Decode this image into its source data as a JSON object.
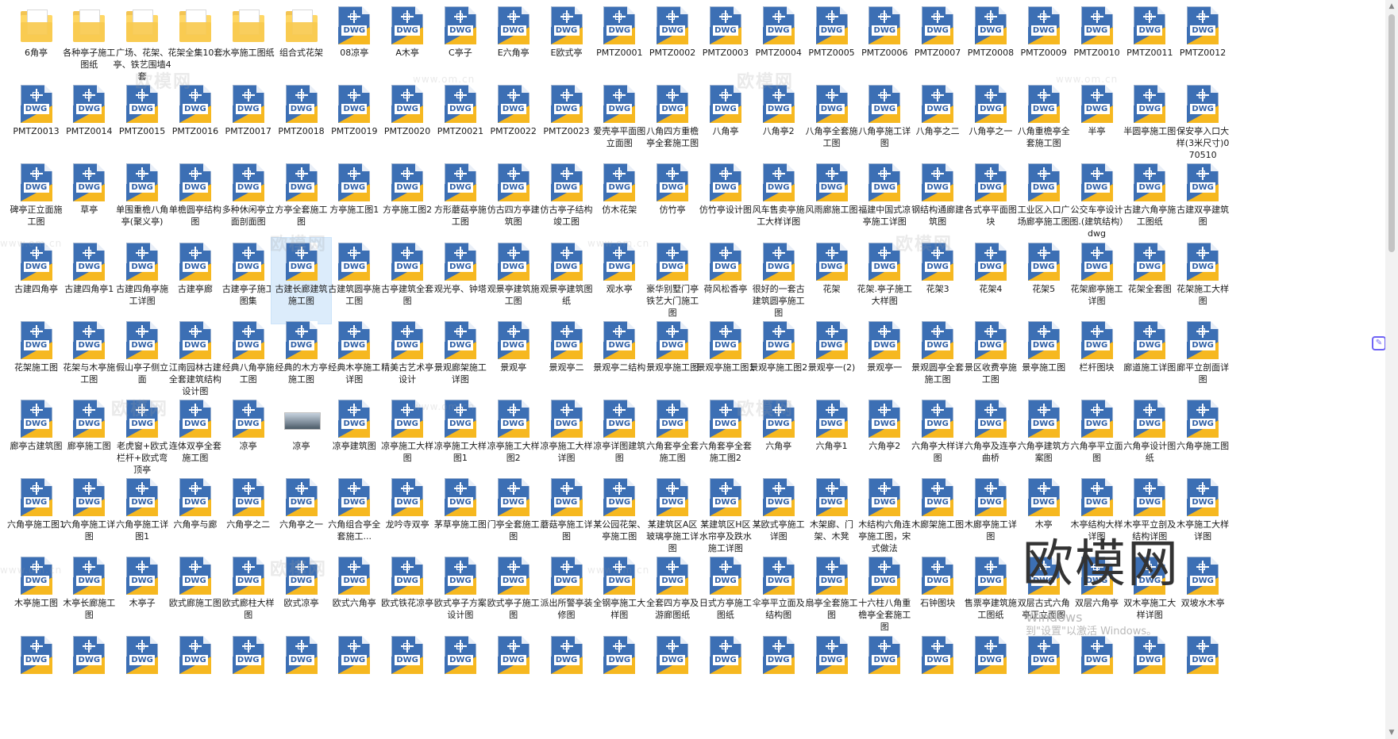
{
  "icon_badge": "DWG",
  "colors": {
    "dwg_blue": "#3c6fb4",
    "dwg_yellow": "#f6b820",
    "folder": "#ffd765",
    "selection": "#dcecfb"
  },
  "watermarks": {
    "brand": "欧模网",
    "url": "www.om.cn"
  },
  "big_watermark": "欧模网",
  "activation": {
    "line1": "Windows",
    "line2": "到\"设置\"以激活 Windows。"
  },
  "selected_index": 74,
  "files": [
    {
      "name": "6角亭",
      "type": "folder"
    },
    {
      "name": "各种亭子施工图纸",
      "type": "folder"
    },
    {
      "name": "广场、花架、亭、铁艺围墙4套",
      "type": "folder"
    },
    {
      "name": "花架全集10套",
      "type": "folder"
    },
    {
      "name": "水亭施工图纸",
      "type": "folder"
    },
    {
      "name": "组合式花架",
      "type": "folder"
    },
    {
      "name": "08凉亭",
      "type": "dwg"
    },
    {
      "name": "A木亭",
      "type": "dwg"
    },
    {
      "name": "C亭子",
      "type": "dwg"
    },
    {
      "name": "E六角亭",
      "type": "dwg"
    },
    {
      "name": "E欧式亭",
      "type": "dwg"
    },
    {
      "name": "PMTZ0001",
      "type": "dwg"
    },
    {
      "name": "PMTZ0002",
      "type": "dwg"
    },
    {
      "name": "PMTZ0003",
      "type": "dwg"
    },
    {
      "name": "PMTZ0004",
      "type": "dwg"
    },
    {
      "name": "PMTZ0005",
      "type": "dwg"
    },
    {
      "name": "PMTZ0006",
      "type": "dwg"
    },
    {
      "name": "PMTZ0007",
      "type": "dwg"
    },
    {
      "name": "PMTZ0008",
      "type": "dwg"
    },
    {
      "name": "PMTZ0009",
      "type": "dwg"
    },
    {
      "name": "PMTZ0010",
      "type": "dwg"
    },
    {
      "name": "PMTZ0011",
      "type": "dwg"
    },
    {
      "name": "PMTZ0012",
      "type": "dwg"
    },
    {
      "name": "PMTZ0013",
      "type": "dwg"
    },
    {
      "name": "PMTZ0014",
      "type": "dwg"
    },
    {
      "name": "PMTZ0015",
      "type": "dwg"
    },
    {
      "name": "PMTZ0016",
      "type": "dwg"
    },
    {
      "name": "PMTZ0017",
      "type": "dwg"
    },
    {
      "name": "PMTZ0018",
      "type": "dwg"
    },
    {
      "name": "PMTZ0019",
      "type": "dwg"
    },
    {
      "name": "PMTZ0020",
      "type": "dwg"
    },
    {
      "name": "PMTZ0021",
      "type": "dwg"
    },
    {
      "name": "PMTZ0022",
      "type": "dwg"
    },
    {
      "name": "PMTZ0023",
      "type": "dwg"
    },
    {
      "name": "爱壳亭平面图立面图",
      "type": "dwg"
    },
    {
      "name": "八角四方重檐亭全套施工图",
      "type": "dwg"
    },
    {
      "name": "八角亭",
      "type": "dwg"
    },
    {
      "name": "八角亭2",
      "type": "dwg"
    },
    {
      "name": "八角亭全套施工图",
      "type": "dwg"
    },
    {
      "name": "八角亭施工详图",
      "type": "dwg"
    },
    {
      "name": "八角亭之二",
      "type": "dwg"
    },
    {
      "name": "八角亭之一",
      "type": "dwg"
    },
    {
      "name": "八角重檐亭全套施工图",
      "type": "dwg"
    },
    {
      "name": "半亭",
      "type": "dwg"
    },
    {
      "name": "半圆亭施工图",
      "type": "dwg"
    },
    {
      "name": "保安亭入口大样(3米尺寸)070510",
      "type": "dwg"
    },
    {
      "name": "碑亭正立面施工图",
      "type": "dwg"
    },
    {
      "name": "草亭",
      "type": "dwg"
    },
    {
      "name": "单围重檐八角亭(聚义亭)",
      "type": "dwg"
    },
    {
      "name": "单檐圆亭结构图",
      "type": "dwg"
    },
    {
      "name": "多种休闲亭立面剖面图",
      "type": "dwg"
    },
    {
      "name": "方亭全套施工图",
      "type": "dwg"
    },
    {
      "name": "方亭施工图1",
      "type": "dwg"
    },
    {
      "name": "方亭施工图2",
      "type": "dwg"
    },
    {
      "name": "方形蘑菇亭施工图",
      "type": "dwg"
    },
    {
      "name": "仿古四方亭建筑图",
      "type": "dwg"
    },
    {
      "name": "仿古亭子结构竣工图",
      "type": "dwg"
    },
    {
      "name": "仿木花架",
      "type": "dwg"
    },
    {
      "name": "仿竹亭",
      "type": "dwg"
    },
    {
      "name": "仿竹亭设计图",
      "type": "dwg"
    },
    {
      "name": "风车售卖亭施工大样详图",
      "type": "dwg"
    },
    {
      "name": "风雨廊施工图",
      "type": "dwg"
    },
    {
      "name": "福建中国式凉亭施工详图",
      "type": "dwg"
    },
    {
      "name": "钢结构通廊建筑图",
      "type": "dwg"
    },
    {
      "name": "各式亭平面图块",
      "type": "dwg"
    },
    {
      "name": "工业区入口广场廊亭施工图",
      "type": "dwg"
    },
    {
      "name": "公交车亭设计图.(建筑结构）dwg",
      "type": "dwg"
    },
    {
      "name": "古建六角亭施工图纸",
      "type": "dwg"
    },
    {
      "name": "古建双亭建筑图",
      "type": "dwg"
    },
    {
      "name": "古建四角亭",
      "type": "dwg"
    },
    {
      "name": "古建四角亭1",
      "type": "dwg"
    },
    {
      "name": "古建四角亭施工详图",
      "type": "dwg"
    },
    {
      "name": "古建亭廊",
      "type": "dwg"
    },
    {
      "name": "古建亭子施工图集",
      "type": "dwg"
    },
    {
      "name": "古建长廊建筑施工图",
      "type": "dwg"
    },
    {
      "name": "古建筑圆亭施工图",
      "type": "dwg"
    },
    {
      "name": "古亭建筑全套图",
      "type": "dwg"
    },
    {
      "name": "观光亭、钟塔",
      "type": "dwg"
    },
    {
      "name": "观景亭建筑施工图",
      "type": "dwg"
    },
    {
      "name": "观景亭建筑图纸",
      "type": "dwg"
    },
    {
      "name": "观水亭",
      "type": "dwg"
    },
    {
      "name": "豪华别墅门亭铁艺大门施工图",
      "type": "dwg"
    },
    {
      "name": "荷风松香亭",
      "type": "dwg"
    },
    {
      "name": "很好的一套古建筑圆亭施工图",
      "type": "dwg"
    },
    {
      "name": "花架",
      "type": "dwg"
    },
    {
      "name": "花架.亭子施工大样图",
      "type": "dwg"
    },
    {
      "name": "花架3",
      "type": "dwg"
    },
    {
      "name": "花架4",
      "type": "dwg"
    },
    {
      "name": "花架5",
      "type": "dwg"
    },
    {
      "name": "花架廊亭施工详图",
      "type": "dwg"
    },
    {
      "name": "花架全套图",
      "type": "dwg"
    },
    {
      "name": "花架施工大样图",
      "type": "dwg"
    },
    {
      "name": "花架施工图",
      "type": "dwg"
    },
    {
      "name": "花架与木亭施工图",
      "type": "dwg"
    },
    {
      "name": "假山亭子侧立面",
      "type": "dwg"
    },
    {
      "name": "江南园林古建全套建筑结构设计图",
      "type": "dwg"
    },
    {
      "name": "经典八角亭施工图",
      "type": "dwg"
    },
    {
      "name": "经典的木方亭施工图",
      "type": "dwg"
    },
    {
      "name": "经典木亭施工详图",
      "type": "dwg"
    },
    {
      "name": "精美古艺术亭设计",
      "type": "dwg"
    },
    {
      "name": "景观廊架施工详图",
      "type": "dwg"
    },
    {
      "name": "景观亭",
      "type": "dwg"
    },
    {
      "name": "景观亭二",
      "type": "dwg"
    },
    {
      "name": "景观亭二结构",
      "type": "dwg"
    },
    {
      "name": "景观亭施工图",
      "type": "dwg"
    },
    {
      "name": "景观亭施工图1",
      "type": "dwg"
    },
    {
      "name": "景观亭施工图2",
      "type": "dwg"
    },
    {
      "name": "景观亭一(2)",
      "type": "dwg"
    },
    {
      "name": "景观亭一",
      "type": "dwg"
    },
    {
      "name": "景观圆亭全套施工图",
      "type": "dwg"
    },
    {
      "name": "景区收费亭施工图",
      "type": "dwg"
    },
    {
      "name": "景亭施工图",
      "type": "dwg"
    },
    {
      "name": "栏杆图块",
      "type": "dwg"
    },
    {
      "name": "廊道施工详图",
      "type": "dwg"
    },
    {
      "name": "廊平立剖面详图",
      "type": "dwg"
    },
    {
      "name": "廊亭古建筑图",
      "type": "dwg"
    },
    {
      "name": "廊亭施工图",
      "type": "dwg"
    },
    {
      "name": "老虎窗+欧式栏杆+欧式弯顶亭",
      "type": "dwg"
    },
    {
      "name": "连体双亭全套施工图",
      "type": "dwg"
    },
    {
      "name": "凉亭",
      "type": "dwg"
    },
    {
      "name": "凉亭",
      "type": "image"
    },
    {
      "name": "凉亭建筑图",
      "type": "dwg"
    },
    {
      "name": "凉亭施工大样图",
      "type": "dwg"
    },
    {
      "name": "凉亭施工大样图1",
      "type": "dwg"
    },
    {
      "name": "凉亭施工大样图2",
      "type": "dwg"
    },
    {
      "name": "凉亭施工大样详图",
      "type": "dwg"
    },
    {
      "name": "凉亭详图建筑图",
      "type": "dwg"
    },
    {
      "name": "六角套亭全套施工图",
      "type": "dwg"
    },
    {
      "name": "六角套亭全套施工图2",
      "type": "dwg"
    },
    {
      "name": "六角亭",
      "type": "dwg"
    },
    {
      "name": "六角亭1",
      "type": "dwg"
    },
    {
      "name": "六角亭2",
      "type": "dwg"
    },
    {
      "name": "六角亭大样详图",
      "type": "dwg"
    },
    {
      "name": "六角亭及连亭曲桥",
      "type": "dwg"
    },
    {
      "name": "六角亭建筑方案图",
      "type": "dwg"
    },
    {
      "name": "六角亭平立面图",
      "type": "dwg"
    },
    {
      "name": "六角亭设计图纸",
      "type": "dwg"
    },
    {
      "name": "六角亭施工图",
      "type": "dwg"
    },
    {
      "name": "六角亭施工图1",
      "type": "dwg"
    },
    {
      "name": "六角亭施工详图",
      "type": "dwg"
    },
    {
      "name": "六角亭施工详图1",
      "type": "dwg"
    },
    {
      "name": "六角亭与廊",
      "type": "dwg"
    },
    {
      "name": "六角亭之二",
      "type": "dwg"
    },
    {
      "name": "六角亭之一",
      "type": "dwg"
    },
    {
      "name": "六角组合亭全套施工...",
      "type": "dwg"
    },
    {
      "name": "龙吟寺双亭",
      "type": "dwg"
    },
    {
      "name": "茅草亭施工图",
      "type": "dwg"
    },
    {
      "name": "门亭全套施工图",
      "type": "dwg"
    },
    {
      "name": "蘑菇亭施工详图",
      "type": "dwg"
    },
    {
      "name": "某公园花架、亭施工图",
      "type": "dwg"
    },
    {
      "name": "某建筑区A区玻璃亭施工详图",
      "type": "dwg"
    },
    {
      "name": "某建筑区H区水帘亭及跌水施工详图",
      "type": "dwg"
    },
    {
      "name": "某欧式亭施工详图",
      "type": "dwg"
    },
    {
      "name": "木架廊、门架、木凳",
      "type": "dwg"
    },
    {
      "name": "木结构六角连亭施工图，宋式做法",
      "type": "dwg"
    },
    {
      "name": "木廊架施工图",
      "type": "dwg"
    },
    {
      "name": "木廊亭施工详图",
      "type": "dwg"
    },
    {
      "name": "木亭",
      "type": "dwg"
    },
    {
      "name": "木亭结构大样详图",
      "type": "dwg"
    },
    {
      "name": "木亭平立剖及结构详图",
      "type": "dwg"
    },
    {
      "name": "木亭施工大样详图",
      "type": "dwg"
    },
    {
      "name": "木亭施工图",
      "type": "dwg"
    },
    {
      "name": "木亭长廊施工图",
      "type": "dwg"
    },
    {
      "name": "木亭子",
      "type": "dwg"
    },
    {
      "name": "欧式廊施工图",
      "type": "dwg"
    },
    {
      "name": "欧式廊柱大样图",
      "type": "dwg"
    },
    {
      "name": "欧式凉亭",
      "type": "dwg"
    },
    {
      "name": "欧式六角亭",
      "type": "dwg"
    },
    {
      "name": "欧式铁花凉亭",
      "type": "dwg"
    },
    {
      "name": "欧式亭子方案设计图",
      "type": "dwg"
    },
    {
      "name": "欧式亭子施工图",
      "type": "dwg"
    },
    {
      "name": "派出所警亭装修图",
      "type": "dwg"
    },
    {
      "name": "全钢亭施工大样图",
      "type": "dwg"
    },
    {
      "name": "全套四方亭及游廊图纸",
      "type": "dwg"
    },
    {
      "name": "日式方亭施工图纸",
      "type": "dwg"
    },
    {
      "name": "伞亭平立面及结构图",
      "type": "dwg"
    },
    {
      "name": "扇亭全套施工图",
      "type": "dwg"
    },
    {
      "name": "十六柱八角重檐亭全套施工图",
      "type": "dwg"
    },
    {
      "name": "石钟图块",
      "type": "dwg"
    },
    {
      "name": "售票亭建筑施工图纸",
      "type": "dwg"
    },
    {
      "name": "双层古式六角亭正立面图",
      "type": "dwg"
    },
    {
      "name": "双层六角亭",
      "type": "dwg"
    },
    {
      "name": "双木亭施工大样详图",
      "type": "dwg"
    },
    {
      "name": "双坡水木亭",
      "type": "dwg"
    },
    {
      "name": "",
      "type": "dwg"
    },
    {
      "name": "",
      "type": "dwg"
    },
    {
      "name": "",
      "type": "dwg"
    },
    {
      "name": "",
      "type": "dwg"
    },
    {
      "name": "",
      "type": "dwg"
    },
    {
      "name": "",
      "type": "dwg"
    },
    {
      "name": "",
      "type": "dwg"
    },
    {
      "name": "",
      "type": "dwg"
    },
    {
      "name": "",
      "type": "dwg"
    },
    {
      "name": "",
      "type": "dwg"
    },
    {
      "name": "",
      "type": "dwg"
    },
    {
      "name": "",
      "type": "dwg"
    },
    {
      "name": "",
      "type": "dwg"
    },
    {
      "name": "",
      "type": "dwg"
    },
    {
      "name": "",
      "type": "dwg"
    },
    {
      "name": "",
      "type": "dwg"
    },
    {
      "name": "",
      "type": "dwg"
    },
    {
      "name": "",
      "type": "dwg"
    },
    {
      "name": "",
      "type": "dwg"
    },
    {
      "name": "",
      "type": "dwg"
    },
    {
      "name": "",
      "type": "dwg"
    },
    {
      "name": "",
      "type": "dwg"
    },
    {
      "name": "",
      "type": "dwg"
    }
  ]
}
